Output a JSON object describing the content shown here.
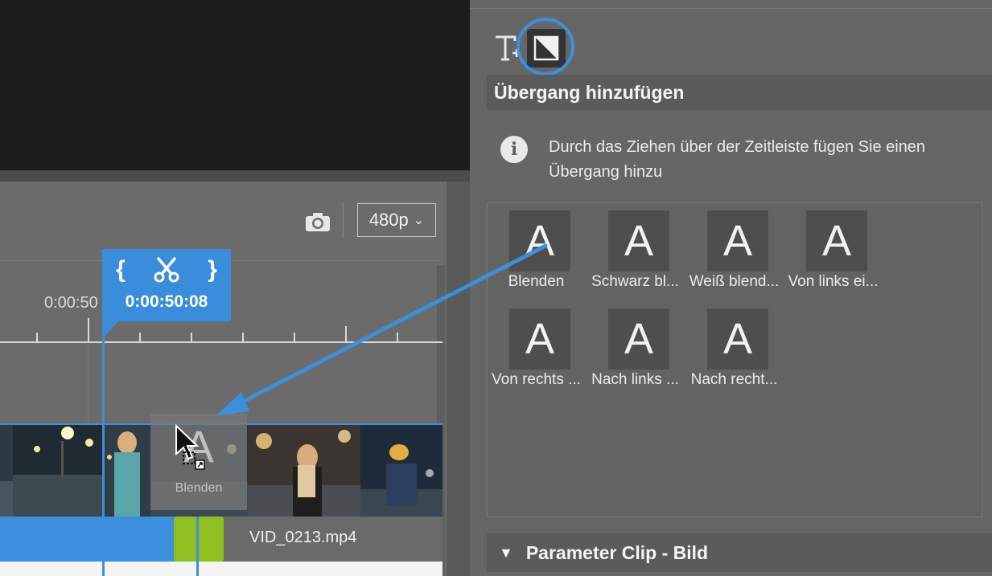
{
  "preview": {},
  "toolbar": {
    "resolution": "480p",
    "resolution_chevron": "⌄",
    "camera_icon": "camera-icon"
  },
  "ruler": {
    "label": "0:00:50"
  },
  "playhead": {
    "open_bracket": "{",
    "close_bracket": "}",
    "time": "0:00:50:08"
  },
  "timeline": {
    "clip_name": "VID_0213.mp4",
    "drop_ghost_label": "Blenden",
    "drop_ghost_glyph": "A",
    "marker_color": "#8fbf21",
    "accent": "#3b8fdc"
  },
  "panel": {
    "section_title": "Übergang hinzufügen",
    "info_icon_glyph": "i",
    "info_text": "Durch das Ziehen über der Zeitleiste fügen Sie einen Übergang hinzu",
    "tiles": [
      {
        "glyph": "A",
        "label": "Blenden"
      },
      {
        "glyph": "A",
        "label": "Schwarz bl..."
      },
      {
        "glyph": "A",
        "label": "Weiß blend..."
      },
      {
        "glyph": "A",
        "label": "Von links ei..."
      },
      {
        "glyph": "A",
        "label": "Von rechts ..."
      },
      {
        "glyph": "A",
        "label": "Nach links ..."
      },
      {
        "glyph": "A",
        "label": "Nach recht..."
      }
    ],
    "params_header": "Parameter Clip - Bild",
    "params_triangle": "▼"
  }
}
